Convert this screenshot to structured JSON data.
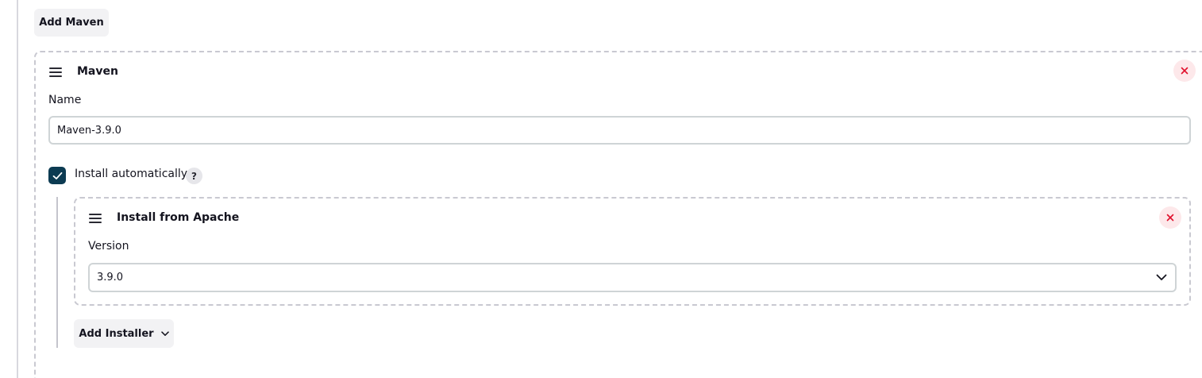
{
  "toolbar": {
    "add_maven_label": "Add Maven"
  },
  "maven_card": {
    "title": "Maven",
    "name_label": "Name",
    "name_value": "Maven-3.9.0",
    "install_auto_label": "Install automatically",
    "install_auto_checked": true,
    "help_label": "?"
  },
  "installer_card": {
    "title": "Install from Apache",
    "version_label": "Version",
    "version_value": "3.9.0"
  },
  "add_installer_label": "Add Installer",
  "icons": {
    "drag": "drag-handle-icon",
    "close": "close-icon",
    "check": "check-icon",
    "chevron": "chevron-down-icon"
  },
  "colors": {
    "checkbox_fill": "#0c3b52",
    "close_bg": "#fde8ea",
    "close_fg": "#e0102c",
    "button_bg": "#f2f2f4"
  }
}
